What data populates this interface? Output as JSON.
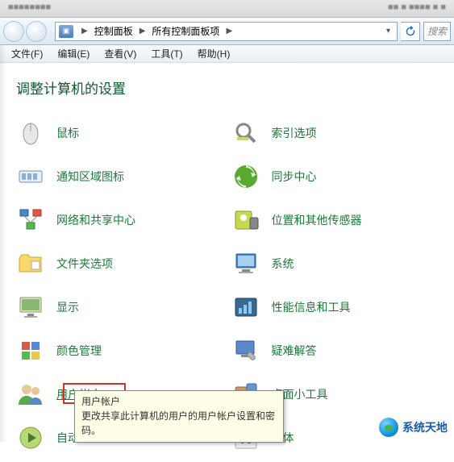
{
  "titlebar": {
    "left_blur": "■■■■■■■■",
    "right_blur": "■■ ■ ■■■■ ■ ■"
  },
  "breadcrumb": {
    "root_icon": "▣",
    "item1": "控制面板",
    "item2": "所有控制面板项"
  },
  "search": {
    "placeholder": "搜索"
  },
  "menu": {
    "file": "文件(F)",
    "edit": "编辑(E)",
    "view": "查看(V)",
    "tools": "工具(T)",
    "help": "帮助(H)"
  },
  "heading": "调整计算机的设置",
  "items": {
    "mouse": "鼠标",
    "indexing": "索引选项",
    "notification": "通知区域图标",
    "sync": "同步中心",
    "network": "网络和共享中心",
    "location": "位置和其他传感器",
    "folder": "文件夹选项",
    "system": "系统",
    "display": "显示",
    "perf": "性能信息和工具",
    "color": "颜色管理",
    "trouble": "疑难解答",
    "user": "用户帐户",
    "gadgets": "桌面小工具",
    "autoplay": "自动",
    "fonts": "字体"
  },
  "tooltip": {
    "title": "用户帐户",
    "body": "更改共享此计算机的用户的用户帐户设置和密码。"
  },
  "watermark": "系统天地"
}
